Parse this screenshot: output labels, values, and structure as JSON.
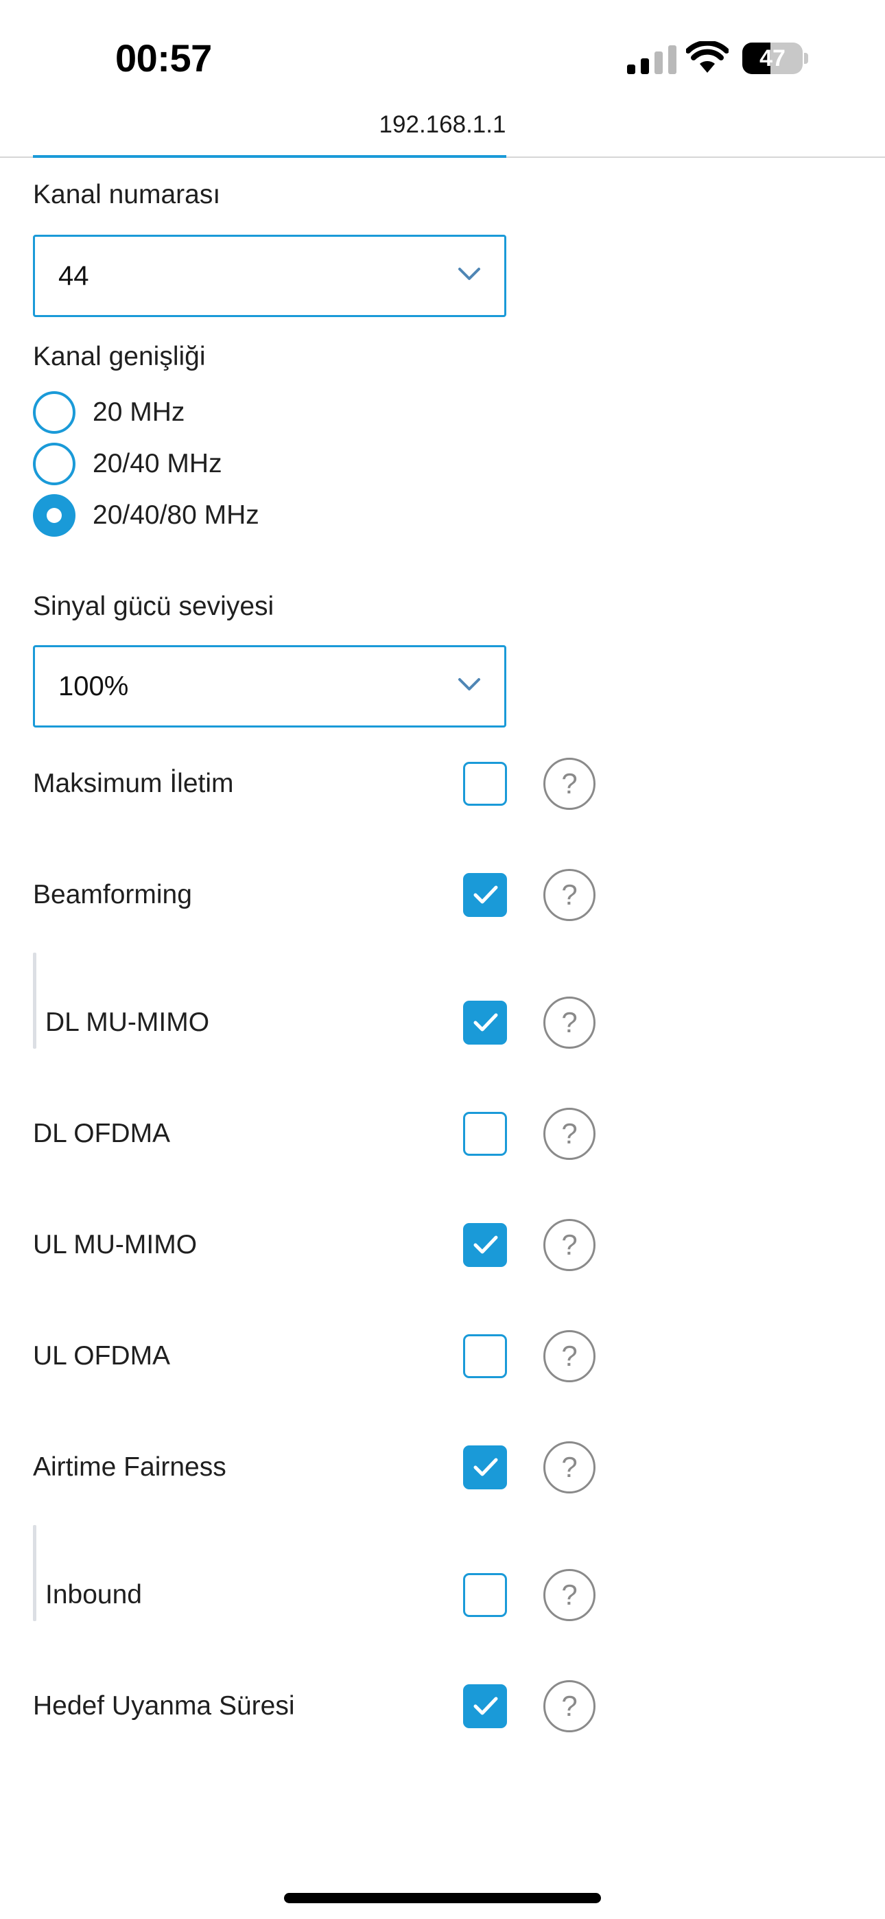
{
  "status_bar": {
    "time": "00:57",
    "battery": "47",
    "battery_level_percent": 47
  },
  "browser": {
    "url": "192.168.1.1"
  },
  "channel_number": {
    "label": "Kanal numarası",
    "value": "44"
  },
  "channel_width": {
    "label": "Kanal genişliği",
    "options": [
      {
        "label": "20 MHz",
        "selected": false
      },
      {
        "label": "20/40 MHz",
        "selected": false
      },
      {
        "label": "20/40/80 MHz",
        "selected": true
      }
    ]
  },
  "signal_strength": {
    "label": "Sinyal gücü seviyesi",
    "value": "100%"
  },
  "options": [
    {
      "label": "Maksimum İletim",
      "checked": false,
      "nested": false
    },
    {
      "label": "Beamforming",
      "checked": true,
      "nested": false
    },
    {
      "label": "DL MU-MIMO",
      "checked": true,
      "nested": true
    },
    {
      "label": "DL OFDMA",
      "checked": false,
      "nested": false
    },
    {
      "label": "UL MU-MIMO",
      "checked": true,
      "nested": false
    },
    {
      "label": "UL OFDMA",
      "checked": false,
      "nested": false
    },
    {
      "label": "Airtime Fairness",
      "checked": true,
      "nested": false
    },
    {
      "label": "Inbound",
      "checked": false,
      "nested": true
    },
    {
      "label": "Hedef Uyanma Süresi",
      "checked": true,
      "nested": false
    }
  ],
  "help_symbol": "?",
  "colors": {
    "accent": "#1a9ad8",
    "help_gray": "#8a8a8a"
  },
  "icons": {
    "dropdown": "chevron-down-icon",
    "check": "checkmark-icon",
    "help": "question-circle-icon"
  }
}
